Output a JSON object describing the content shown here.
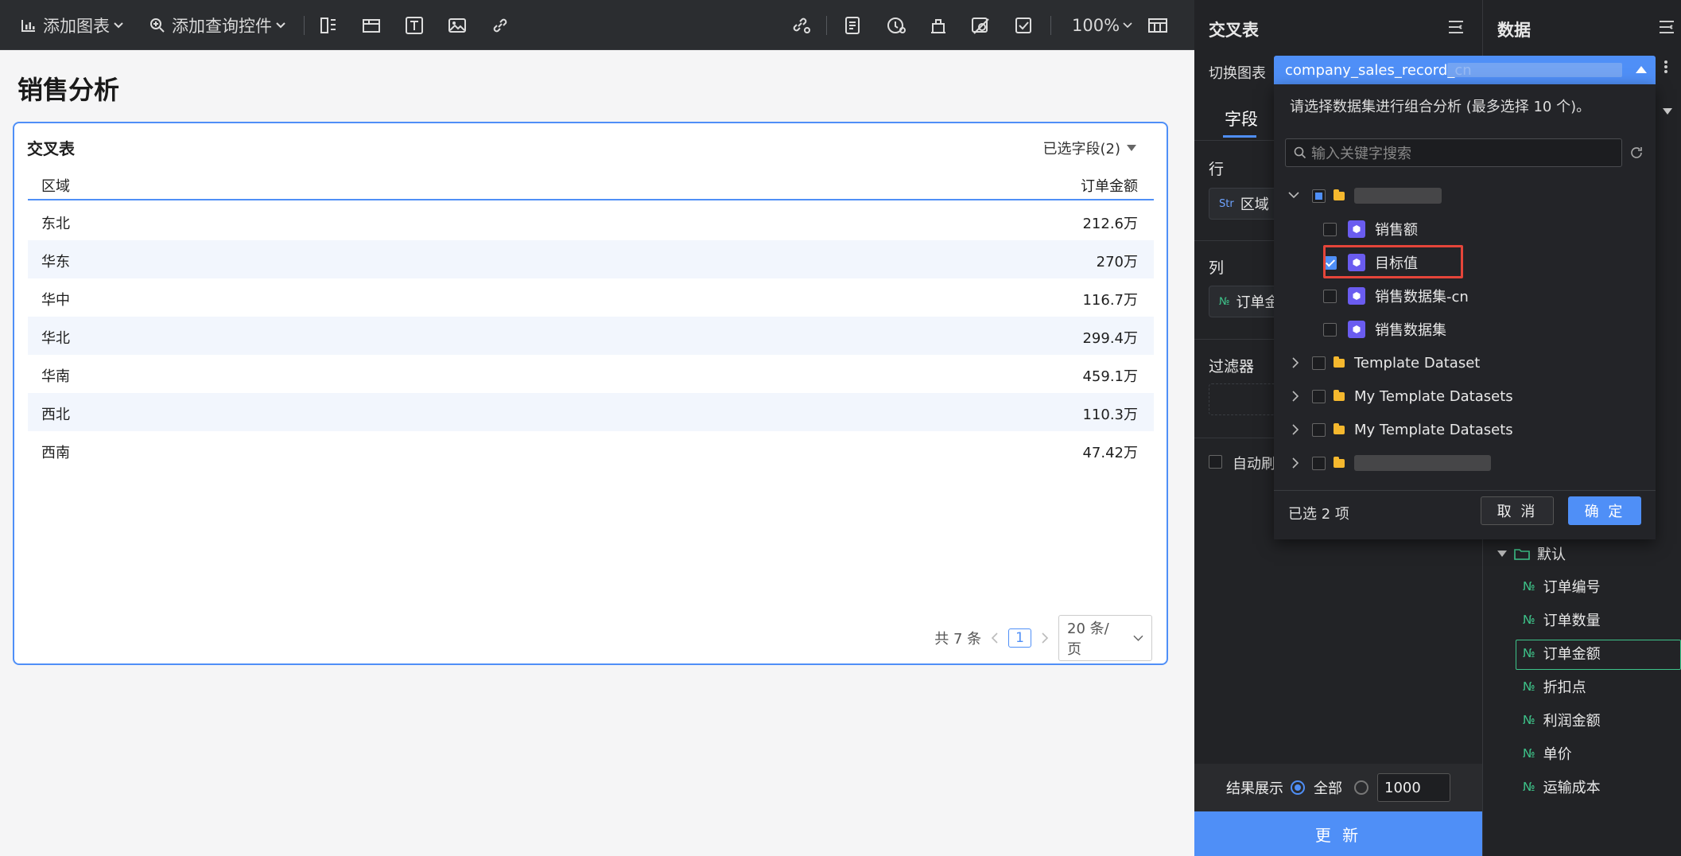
{
  "toolbar": {
    "add_chart": "添加图表",
    "add_query_control": "添加查询控件",
    "zoom": "100%"
  },
  "page": {
    "title": "销售分析"
  },
  "card": {
    "title": "交叉表",
    "selected_fields": "已选字段(2)",
    "columns": [
      "区域",
      "订单金额"
    ],
    "rows": [
      [
        "东北",
        "212.6万"
      ],
      [
        "华东",
        "270万"
      ],
      [
        "华中",
        "116.7万"
      ],
      [
        "华北",
        "299.4万"
      ],
      [
        "华南",
        "459.1万"
      ],
      [
        "西北",
        "110.3万"
      ],
      [
        "西南",
        "47.42万"
      ]
    ],
    "pager": {
      "total": "共 7 条",
      "current": "1",
      "page_size": "20 条/页"
    }
  },
  "config": {
    "title": "交叉表",
    "switch_chart": "切换图表",
    "tab_fields": "字段",
    "row_label": "行",
    "row_chip": {
      "kind": "Str",
      "name": "区域"
    },
    "col_label": "列",
    "col_chip": {
      "kind": "№",
      "name": "订单金"
    },
    "filter_label": "过滤器",
    "auto_refresh": "自动刷",
    "result_label": "结果展示",
    "result_all": "全部",
    "result_limit": "1000",
    "update_button": "更 新"
  },
  "data_panel": {
    "title": "数据",
    "group": "默认",
    "fields": [
      "订单编号",
      "订单数量",
      "订单金额",
      "折扣点",
      "利润金额",
      "单价",
      "运输成本"
    ],
    "field_kind": "№"
  },
  "dropdown": {
    "selected_value": "company_sales_record_cn",
    "hint": "请选择数据集进行组合分析 (最多选择 10 个)。",
    "search_placeholder": "输入关键字搜索",
    "tree": [
      {
        "label": "销售额",
        "checked": false
      },
      {
        "label": "目标值",
        "checked": true
      },
      {
        "label": "销售数据集-cn",
        "checked": false
      },
      {
        "label": "销售数据集",
        "checked": false
      }
    ],
    "folders": [
      "Template Dataset",
      "My Template Datasets",
      "My Template Datasets"
    ],
    "selected_count": "已选 2 项",
    "cancel": "取 消",
    "ok": "确 定"
  },
  "colors": {
    "accent": "#4f8ff7",
    "highlight": "#e5453a",
    "number_field": "#3ec48a"
  }
}
